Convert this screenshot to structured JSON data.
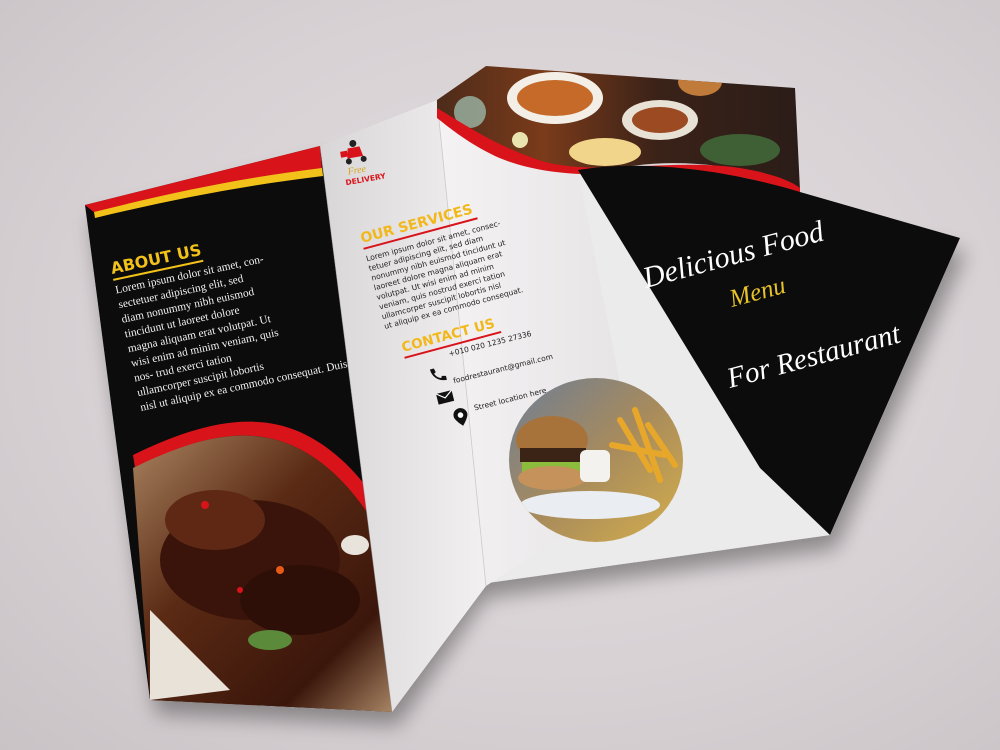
{
  "about": {
    "heading": "ABOUT US",
    "body": "Lorem ipsum dolor sit amet, con- sectetuer adipiscing elit, sed diam nonummy nibh euismod tincidunt ut laoreet dolore magna aliquam erat volutpat. Ut wisi enim ad minim veniam, quis nos- trud exerci tation ullamcorper suscipit lobortis nisl ut aliquip ex ea commodo consequat. Duis"
  },
  "delivery": {
    "line1": "Free",
    "line2": "DELIVERY"
  },
  "services": {
    "heading": "OUR SERVICES",
    "body": "Lorem ipsum dolor sit amet, consec- tetuer adipiscing elit, sed diam nonummy nibh euismod tincidunt ut laoreet dolore magna aliquam erat volutpat. Ut wisi enim ad minim veniam, quis nostrud exerci tation ullamcorper suscipit lobortis nisl ut aliquip ex ea commodo consequat."
  },
  "contact": {
    "heading": "CONTACT US",
    "phone": "+010 020 1235 27336",
    "email": "foodrestaurant@gmail.com",
    "location": "Street location here"
  },
  "cover": {
    "line1": "Delicious Food",
    "line2": "Menu",
    "line3": "For Restaurant"
  },
  "colors": {
    "black": "#0c0c0c",
    "red": "#d8141a",
    "yellow": "#f2c21a",
    "paper": "#efeced"
  }
}
